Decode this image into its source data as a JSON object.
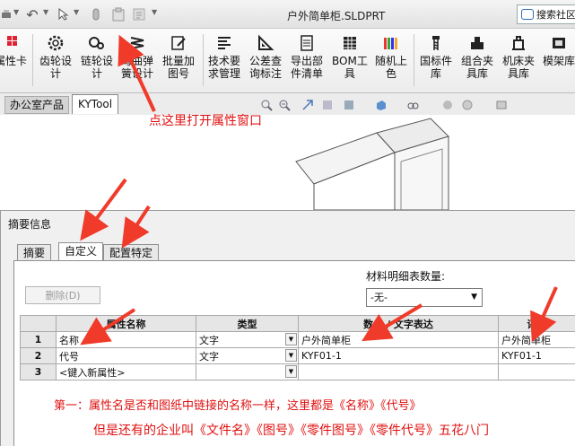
{
  "window": {
    "title": "户外简单柜.SLDPRT",
    "search_label": "搜索社区"
  },
  "ribbon": {
    "buttons": [
      {
        "label": "属性卡",
        "icon": "property-card-icon"
      },
      {
        "label": "齿轮设\n计",
        "icon": "gear-icon"
      },
      {
        "label": "链轮设\n计",
        "icon": "sprocket-icon"
      },
      {
        "label": "弯曲弹\n簧设计",
        "icon": "spring-icon"
      },
      {
        "label": "批量加\n图号",
        "icon": "edit-icon"
      },
      {
        "label": "技术要\n求管理",
        "icon": "list-icon"
      },
      {
        "label": "公差查\n询标注",
        "icon": "triangle-ruler-icon"
      },
      {
        "label": "导出部\n件清单",
        "icon": "document-icon"
      },
      {
        "label": "BOM工\n具",
        "icon": "grid-icon"
      },
      {
        "label": "随机上\n色",
        "icon": "color-bars-icon"
      },
      {
        "label": "国标件\n库",
        "icon": "bolt-icon"
      },
      {
        "label": "组合夹\n具库",
        "icon": "fixture-icon"
      },
      {
        "label": "机床夹\n具库",
        "icon": "clamp-icon"
      },
      {
        "label": "模架库",
        "icon": "mold-icon"
      }
    ]
  },
  "tabs": {
    "office": "办公室产品",
    "kytool": "KYTool"
  },
  "annotations": {
    "top": "点这里打开属性窗口",
    "line1": "第一：属性名是否和图纸中链接的名称一样，这里都是《名称》《代号》",
    "line2": "但是还有的企业叫《文件名》《图号》《零件图号》《零件代号》五花八门"
  },
  "dialog": {
    "title": "摘要信息",
    "tabs": [
      "摘要",
      "自定义",
      "配置特定"
    ],
    "delete_button": "删除(D)",
    "bom_label": "材料明细表数量:",
    "bom_value": "-无-",
    "table": {
      "headers": [
        "",
        "属性名称",
        "类型",
        "数值 / 文字表达",
        "评估"
      ],
      "rows": [
        {
          "num": "1",
          "name": "名称",
          "type": "文字",
          "value": "户外简单柜",
          "eval": "户外简单柜"
        },
        {
          "num": "2",
          "name": "代号",
          "type": "文字",
          "value": "KYF01-1",
          "eval": "KYF01-1"
        },
        {
          "num": "3",
          "name": "<键入新属性>",
          "type": "",
          "value": "",
          "eval": ""
        }
      ]
    }
  },
  "colors": {
    "annotation": "#e01010",
    "arrow": "#f03a2a"
  }
}
